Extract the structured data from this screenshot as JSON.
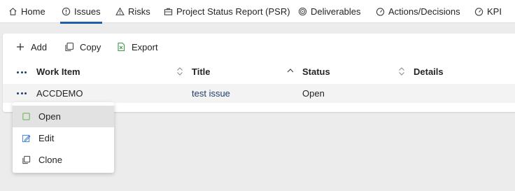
{
  "nav": {
    "tabs": [
      {
        "label": "Home",
        "icon": "home-icon",
        "active": false
      },
      {
        "label": "Issues",
        "icon": "info-circle-icon",
        "active": true
      },
      {
        "label": "Risks",
        "icon": "warning-triangle-icon",
        "active": false
      },
      {
        "label": "Project Status Report (PSR)",
        "icon": "briefcase-icon",
        "active": false
      },
      {
        "label": "Deliverables",
        "icon": "target-icon",
        "active": false
      },
      {
        "label": "Actions/Decisions",
        "icon": "gauge-icon",
        "active": false
      },
      {
        "label": "KPI",
        "icon": "gauge-icon",
        "active": false
      }
    ],
    "accent": "#1f5fa8"
  },
  "toolbar": {
    "add_label": "Add",
    "copy_label": "Copy",
    "export_label": "Export"
  },
  "table": {
    "columns": [
      "Work Item",
      "Title",
      "Status",
      "Details"
    ],
    "rows": [
      {
        "work_item": "ACCDEMO",
        "title": "test issue",
        "status": "Open",
        "details": ""
      }
    ]
  },
  "context_menu": {
    "items": [
      {
        "label": "Open",
        "icon": "open-icon"
      },
      {
        "label": "Edit",
        "icon": "edit-icon"
      },
      {
        "label": "Clone",
        "icon": "clone-icon"
      }
    ]
  },
  "colors": {
    "link": "#1f3d6b",
    "row_bg": "#f3f3f3",
    "page_bg": "#ececec",
    "export_icon": "#3c9b48",
    "open_icon": "#6ab04c",
    "edit_icon": "#3a7bd5"
  }
}
